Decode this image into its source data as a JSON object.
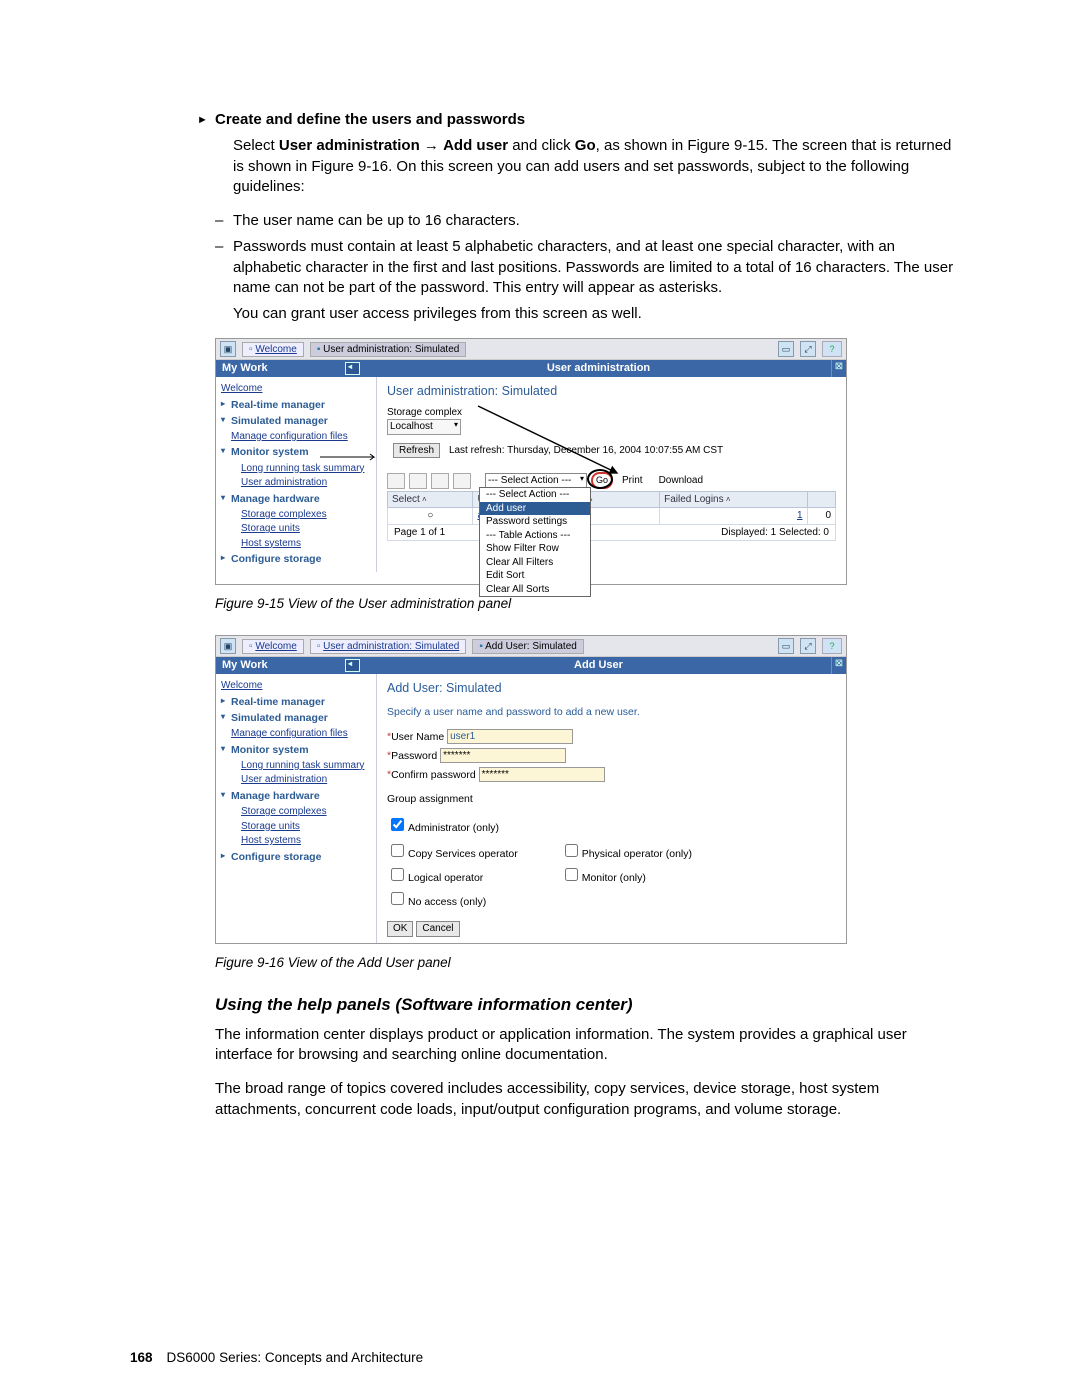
{
  "heading": "Create and define the users and passwords",
  "para1_a": "Select ",
  "para1_b": "User administration",
  "para1_arrow": " → ",
  "para1_c": "Add user",
  "para1_d": " and click ",
  "para1_e": "Go",
  "para1_f": ", as shown in Figure 9-15. The screen that is returned is shown in Figure 9-16. On this screen you can add users and set passwords, subject to the following guidelines:",
  "dash1": "The user name can be up to 16 characters.",
  "dash2": "Passwords must contain at least 5 alphabetic characters, and at least one special character, with an alphabetic character in the first and last positions. Passwords are limited to a total of 16 characters. The user name can not be part of the password. This entry will appear as asterisks.",
  "para2": "You can grant user access privileges from this screen as well.",
  "fig15_caption": "Figure 9-15   View of the User administration panel",
  "fig16_caption": "Figure 9-16   View of the Add User panel",
  "subhead": "Using the help panels (Software information center)",
  "para3": "The information center displays product or application information. The system provides a graphical user interface for browsing and searching online documentation.",
  "para4": "The broad range of topics covered includes accessibility, copy services, device storage, host system attachments, concurrent code loads, input/output configuration programs, and volume storage.",
  "page_number": "168",
  "footer": "DS6000 Series: Concepts and Architecture",
  "fig15": {
    "tabs": {
      "welcome": "Welcome",
      "uas": "User administration: Simulated"
    },
    "mywork": "My Work",
    "panel_title": "User administration",
    "links": {
      "welcome": "Welcome",
      "rtm": "Real-time manager",
      "sim": "Simulated manager",
      "mcf": "Manage configuration files",
      "ms": "Monitor system",
      "lrts": "Long running task summary",
      "ua": "User administration",
      "mh": "Manage hardware",
      "sc": "Storage complexes",
      "su": "Storage units",
      "hs": "Host systems",
      "cs": "Configure storage"
    },
    "main_title": "User administration: Simulated",
    "storage_complex_label": "Storage complex",
    "storage_complex_value": "Localhost",
    "refresh_btn": "Refresh",
    "refresh_text": "Last refresh: Thursday, December 16, 2004 10:07:55 AM CST",
    "action_placeholder": "--- Select Action ---",
    "go_btn": "Go",
    "print_btn": "Print",
    "download_btn": "Download",
    "cols": {
      "select": "Select",
      "user": "User",
      "groups": "ser Groups",
      "failed": "Failed Logins"
    },
    "row1": {
      "user": "adm",
      "failed_a": "1",
      "failed_b": "0"
    },
    "page_info": "Page 1 of 1",
    "disp_info": "Displayed: 1   Selected: 0",
    "menu": {
      "sa": "--- Select Action ---",
      "add": "Add user",
      "pw": "Password settings",
      "ta": "--- Table Actions ---",
      "sfr": "Show Filter Row",
      "caf": "Clear All Filters",
      "es": "Edit Sort",
      "cas": "Clear All Sorts"
    }
  },
  "fig16": {
    "tabs": {
      "welcome": "Welcome",
      "uas": "User administration: Simulated",
      "add": "Add User: Simulated"
    },
    "mywork": "My Work",
    "panel_title": "Add User",
    "links": {
      "welcome": "Welcome",
      "rtm": "Real-time manager",
      "sim": "Simulated manager",
      "mcf": "Manage configuration files",
      "ms": "Monitor system",
      "lrts": "Long running task summary",
      "ua": "User administration",
      "mh": "Manage hardware",
      "sc": "Storage complexes",
      "su": "Storage units",
      "hs": "Host systems",
      "cs": "Configure storage"
    },
    "main_title": "Add User: Simulated",
    "instr": "Specify a user name and password to add a new user.",
    "f_user": "User Name",
    "v_user": "user1",
    "f_pw": "Password",
    "v_pw": "*******",
    "f_cpw": "Confirm password",
    "v_cpw": "*******",
    "group": "Group assignment",
    "g_admin": "Administrator (only)",
    "g_copy": "Copy Services operator",
    "g_phys": "Physical operator (only)",
    "g_log": "Logical operator",
    "g_mon": "Monitor (only)",
    "g_na": "No access (only)",
    "ok": "OK",
    "cancel": "Cancel"
  }
}
